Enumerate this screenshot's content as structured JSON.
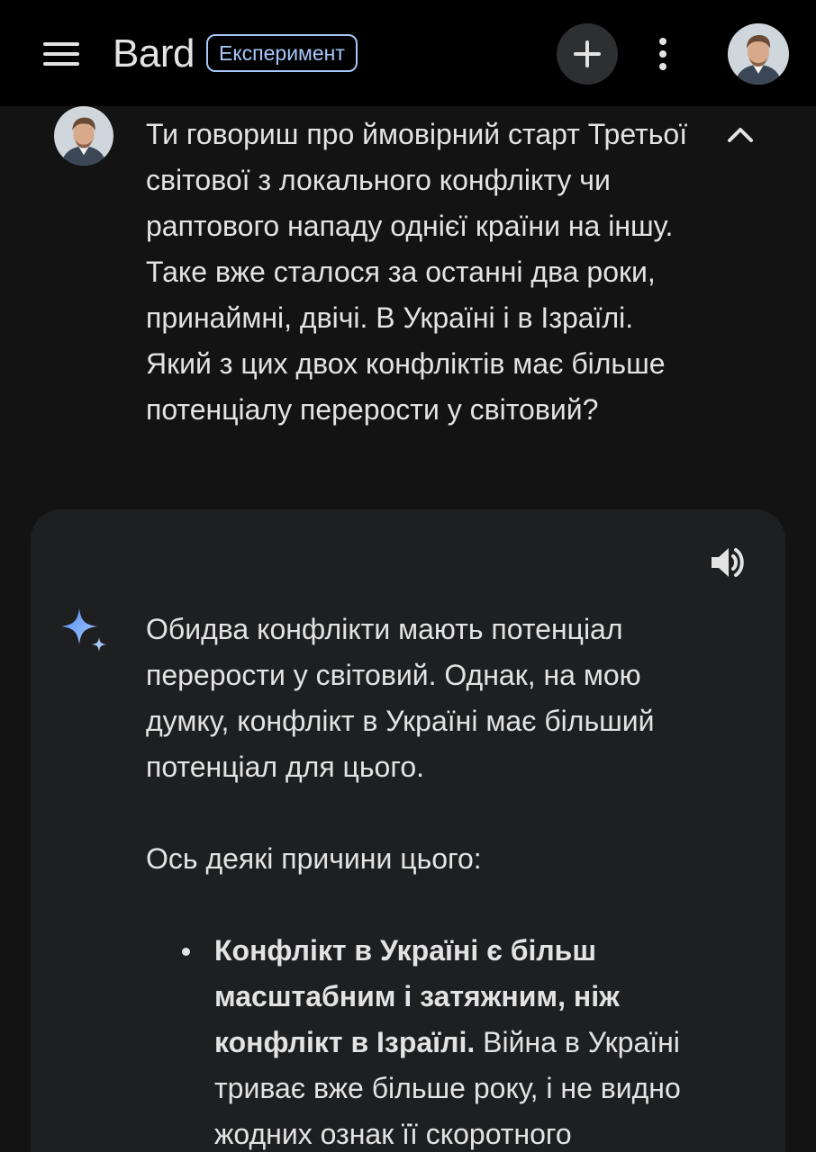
{
  "header": {
    "app_name": "Bard",
    "badge": "Експеримент",
    "menu_icon": "hamburger-menu-icon",
    "new_chat_icon": "plus-icon",
    "more_icon": "more-vert-icon"
  },
  "prompt": {
    "text": "Ти говориш про ймовірний старт Третьої світової з локального конфлікту чи раптового нападу однієї країни на іншу. Таке вже сталося за останні два роки, принаймні, двічі. В Україні і в Ізраїлі. Який з цих двох конфліктів має більше потенціалу перерости у  світовий?",
    "collapse_icon": "chevron-up-icon"
  },
  "response": {
    "paragraph1": "Обидва конфлікти мають потенціал перерости у світовий. Однак, на мою думку, конфлікт в Україні має більший потенціал для цього.",
    "paragraph2": "Ось деякі причини цього:",
    "bullets": [
      {
        "bold": "Конфлікт в Україні є більш масштабним і затяжним, ніж конфлікт в Ізраїлі.",
        "text": " Війна в Україні триває вже більше року, і не видно жодних ознак її скоротного"
      }
    ],
    "speaker_icon": "volume-up-icon",
    "sparkle_icon": "bard-sparkle-icon"
  },
  "colors": {
    "background": "#131314",
    "topbar": "#000000",
    "card": "#1e1f20",
    "accent": "#a8c7fa",
    "text": "#e3e3e3"
  }
}
